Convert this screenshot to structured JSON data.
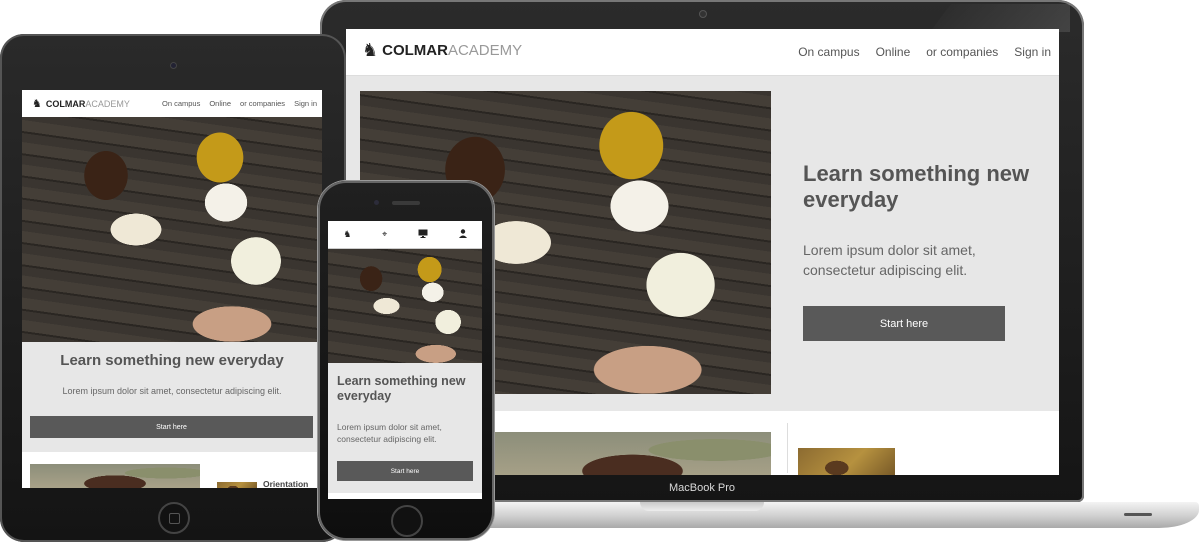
{
  "brand": {
    "strong": "COLMAR",
    "light": "ACADEMY",
    "logo_icon": "lion-rampant-icon"
  },
  "nav": {
    "links": [
      "On campus",
      "Online",
      "or companies",
      "Sign in"
    ]
  },
  "hero": {
    "title": "Learn something new everyday",
    "text": "Lorem ipsum dolor sit amet, consectetur adipiscing elit.",
    "cta": "Start here"
  },
  "tablet": {
    "partial_card_title": "Orientation"
  },
  "laptop": {
    "model_label": "MacBook Pro"
  },
  "phone": {
    "tab_icons": [
      "lion-rampant-icon",
      "compass-icon",
      "monitor-icon",
      "user-icon"
    ]
  },
  "colors": {
    "cta": "#595959",
    "hero_bg": "#e7e7e7",
    "title": "#555555"
  }
}
